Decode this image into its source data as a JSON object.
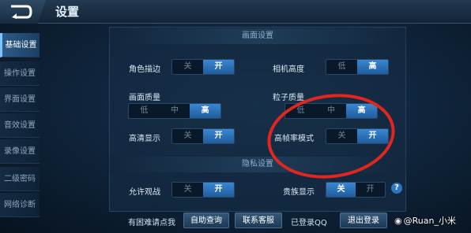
{
  "header": {
    "title": "设置"
  },
  "sidebar": {
    "items": [
      {
        "label": "基础设置"
      },
      {
        "label": "操作设置"
      },
      {
        "label": "界面设置"
      },
      {
        "label": "音效设置"
      },
      {
        "label": "录像设置"
      },
      {
        "label": "二级密码"
      },
      {
        "label": "网络诊断"
      }
    ],
    "active_index": 0
  },
  "sections": {
    "graphics_title": "画面设置",
    "privacy_title": "隐私设置"
  },
  "settings": {
    "outline": {
      "label": "角色描边",
      "options": [
        "关",
        "开"
      ],
      "selected": "开"
    },
    "camera_height": {
      "label": "相机高度",
      "options": [
        "低",
        "高"
      ],
      "selected": "高"
    },
    "quality": {
      "label": "画面质量",
      "options": [
        "低",
        "中",
        "高"
      ],
      "selected": "高"
    },
    "particles": {
      "label": "粒子质量",
      "options": [
        "低",
        "中",
        "高"
      ],
      "selected": "高"
    },
    "hd_display": {
      "label": "高清显示",
      "options": [
        "关",
        "开"
      ],
      "selected": "开"
    },
    "high_fps": {
      "label": "高帧率模式",
      "options": [
        "关",
        "开"
      ],
      "selected": "开"
    },
    "allow_spectate": {
      "label": "允许观战",
      "options": [
        "关",
        "开"
      ],
      "selected": "开"
    },
    "noble_display": {
      "label": "贵族显示",
      "options": [
        "关",
        "开"
      ],
      "selected": "关"
    }
  },
  "help_icon": {
    "text": "?"
  },
  "footer": {
    "trouble_text": "有困难请点我",
    "self_query": "自助查询",
    "contact_service": "联系客服",
    "logged_in": "已登录QQ",
    "logout": "退出登录"
  },
  "watermark": {
    "logo": "◉",
    "text": "@Ruan_小米"
  },
  "colors": {
    "accent": "#2f7dcb",
    "annotation": "#e1261f",
    "background": "#10253d"
  }
}
